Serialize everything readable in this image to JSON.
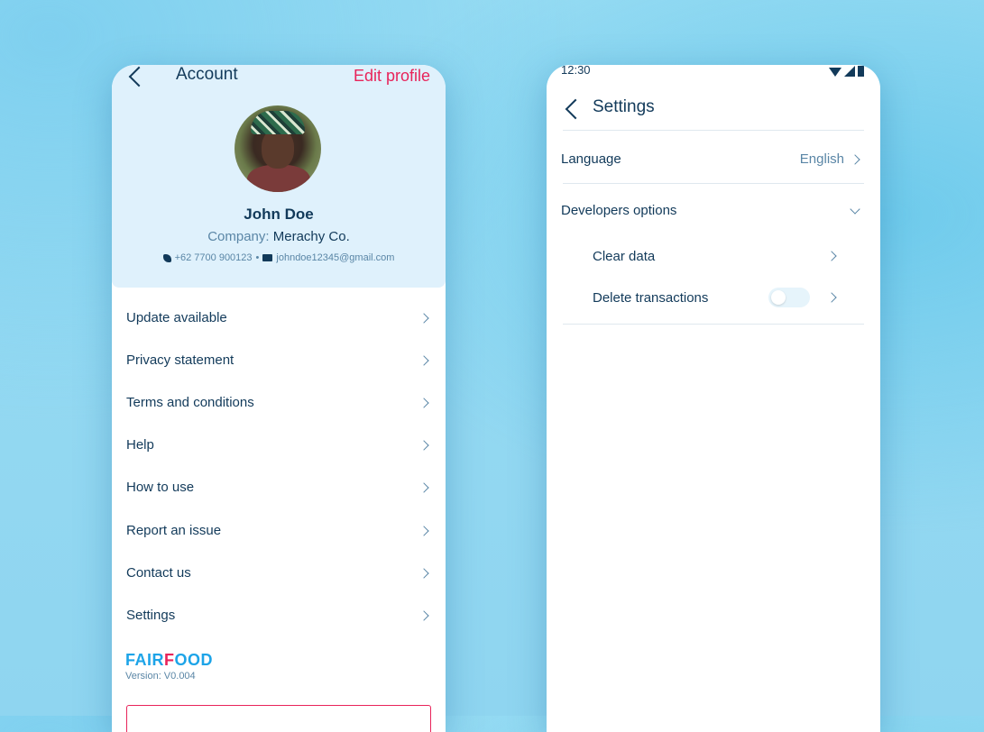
{
  "account": {
    "title": "Account",
    "edit_label": "Edit profile",
    "profile": {
      "name": "John Doe",
      "company_label": "Company:",
      "company_value": "Merachy Co.",
      "phone": "+62 7700 900123",
      "separator": "•",
      "email": "johndoe12345@gmail.com"
    },
    "menu": [
      {
        "label": "Update available"
      },
      {
        "label": "Privacy statement"
      },
      {
        "label": "Terms and conditions"
      },
      {
        "label": "Help"
      },
      {
        "label": "How to use"
      },
      {
        "label": "Report an issue"
      },
      {
        "label": "Contact us"
      },
      {
        "label": "Settings"
      }
    ],
    "brand": {
      "part1": "FAIR",
      "part2": "F",
      "part3": "OOD"
    },
    "version": "Version: V0.004"
  },
  "settings": {
    "status_time": "12:30",
    "title": "Settings",
    "language_label": "Language",
    "language_value": "English",
    "developers_label": "Developers options",
    "clear_data_label": "Clear data",
    "delete_transactions_label": "Delete transactions",
    "delete_transactions_toggle": false
  },
  "colors": {
    "accent": "#e8245a",
    "primary_text": "#123a5a",
    "secondary_text": "#5a86a6",
    "header_bg": "#dff1fc",
    "brand_blue": "#1da4e8"
  }
}
